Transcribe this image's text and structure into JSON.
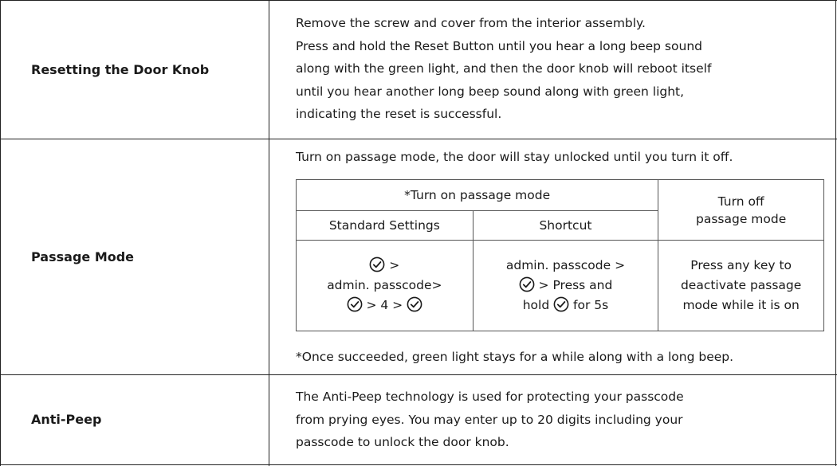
{
  "rows": [
    {
      "label": "Resetting the Door Knob",
      "lines": [
        "Remove the screw and cover from the interior assembly.",
        "Press and hold the Reset Button until you hear a long beep sound",
        "along with the green light, and then the door knob will reboot itself",
        "until you hear another long beep sound along with green light,",
        "indicating the reset is successful."
      ]
    },
    {
      "label": "Passage Mode",
      "intro": "Turn on passage mode, the door will stay unlocked until you turn it off.",
      "table": {
        "header_on": "*Turn on passage mode",
        "header_off_1": "Turn off",
        "header_off_2": "passage mode",
        "col_standard": "Standard Settings",
        "col_shortcut": "Shortcut",
        "standard": {
          "l1_after": ">",
          "l2": "admin. passcode>",
          "l3_mid": "> 4 >"
        },
        "shortcut": {
          "l1": "admin. passcode >",
          "l2_after": "> Press and",
          "l3_before": "hold",
          "l3_after": "for 5s"
        },
        "off": {
          "l1": "Press any key to",
          "l2": "deactivate passage",
          "l3": "mode while it is on"
        }
      },
      "note": "*Once succeeded, green light stays for a while along with a long beep."
    },
    {
      "label": "Anti-Peep",
      "lines": [
        "The Anti-Peep technology is used for protecting your passcode",
        "from prying eyes. You may enter up to 20 digits including your",
        "passcode to unlock the door knob."
      ]
    }
  ]
}
